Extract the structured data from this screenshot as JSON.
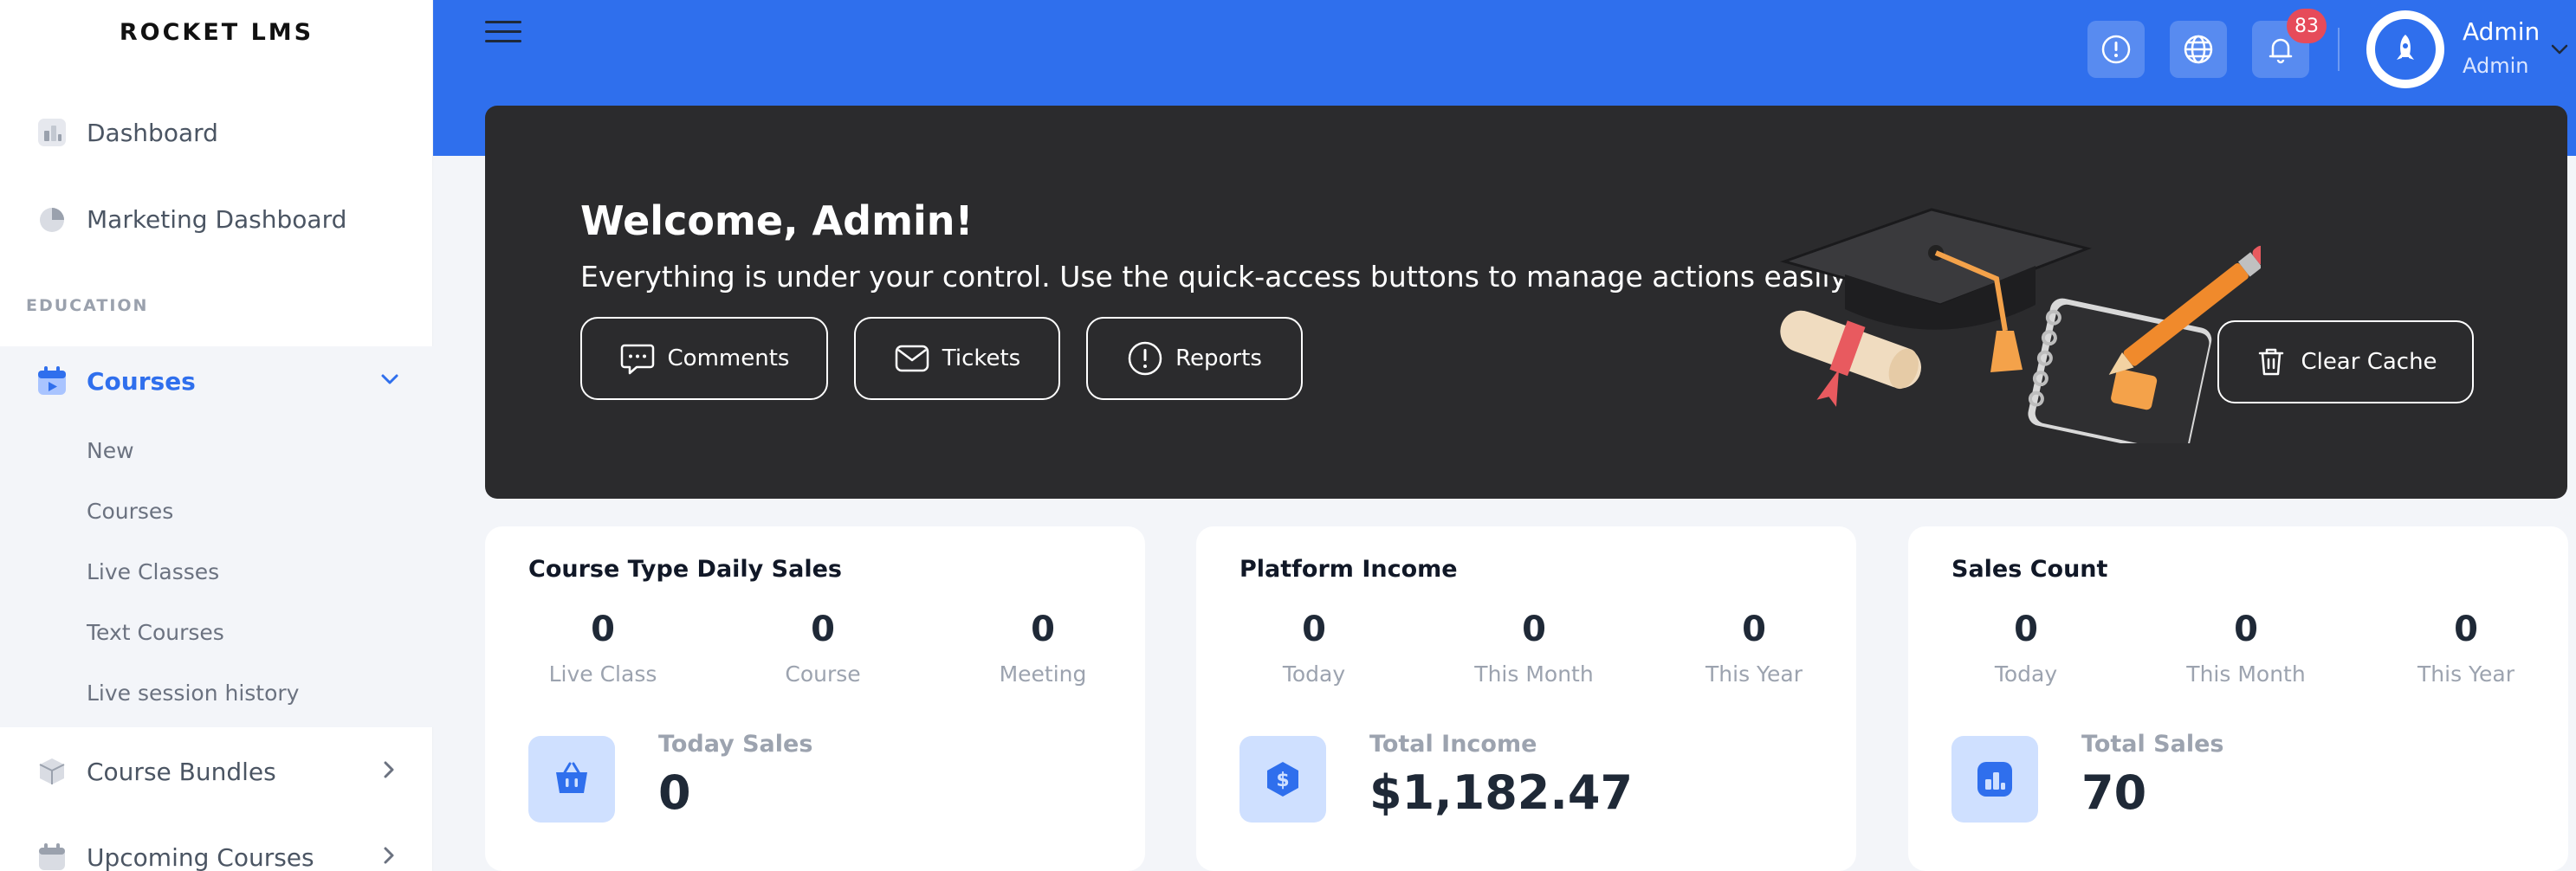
{
  "brand": "ROCKET LMS",
  "sidebar": {
    "dashboard": "Dashboard",
    "marketing_dashboard": "Marketing Dashboard",
    "section_education": "EDUCATION",
    "courses": "Courses",
    "courses_sub": [
      "New",
      "Courses",
      "Live Classes",
      "Text Courses",
      "Live session history"
    ],
    "course_bundles": "Course Bundles",
    "upcoming_courses": "Upcoming Courses"
  },
  "topbar": {
    "notification_count": "83",
    "user_name": "Admin",
    "user_role": "Admin"
  },
  "banner": {
    "title": "Welcome, Admin!",
    "subtitle": "Everything is under your control. Use the quick-access buttons to manage actions easily.",
    "comments": "Comments",
    "tickets": "Tickets",
    "reports": "Reports",
    "clear_cache": "Clear Cache"
  },
  "cards": [
    {
      "title": "Course Type Daily Sales",
      "stats": [
        {
          "value": "0",
          "label": "Live Class"
        },
        {
          "value": "0",
          "label": "Course"
        },
        {
          "value": "0",
          "label": "Meeting"
        }
      ],
      "total_label": "Today Sales",
      "total_value": "0"
    },
    {
      "title": "Platform Income",
      "stats": [
        {
          "value": "0",
          "label": "Today"
        },
        {
          "value": "0",
          "label": "This Month"
        },
        {
          "value": "0",
          "label": "This Year"
        }
      ],
      "total_label": "Total Income",
      "total_value": "$1,182.47"
    },
    {
      "title": "Sales Count",
      "stats": [
        {
          "value": "0",
          "label": "Today"
        },
        {
          "value": "0",
          "label": "This Month"
        },
        {
          "value": "0",
          "label": "This Year"
        }
      ],
      "total_label": "Total Sales",
      "total_value": "70"
    }
  ],
  "colors": {
    "primary": "#2f6fed",
    "banner_bg": "#2b2b2d",
    "badge": "#e64b5a",
    "card_icon_bg": "#cfe0ff"
  }
}
